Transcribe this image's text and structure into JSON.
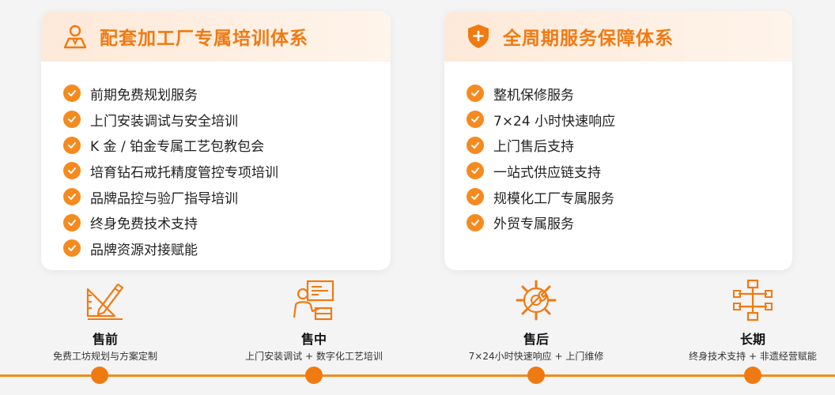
{
  "left_card": {
    "title": "配套加工厂专属培训体系",
    "icon": "person-icon",
    "items": [
      "前期免费规划服务",
      "上门安装调试与安全培训",
      "K 金 / 铂金专属工艺包教包会",
      "培育钻石戒托精度管控专项培训",
      "品牌品控与验厂指导培训",
      "终身免费技术支持",
      "品牌资源对接赋能"
    ]
  },
  "right_card": {
    "title": "全周期服务保障体系",
    "icon": "shield-plus-icon",
    "items": [
      "整机保修服务",
      "7×24 小时快速响应",
      "上门售后支持",
      "一站式供应链支持",
      "规模化工厂专属服务",
      "外贸专属服务"
    ]
  },
  "stages": [
    {
      "title": "售前",
      "desc": "免费工坊规划与方案定制",
      "icon": "ruler-pencil-icon"
    },
    {
      "title": "售中",
      "desc": "上门安装调试 + 数字化工艺培训",
      "icon": "trainer-board-icon"
    },
    {
      "title": "售后",
      "desc": "7×24小时快速响应 + 上门维修",
      "icon": "gear-wrench-icon"
    },
    {
      "title": "长期",
      "desc": "终身技术支持 + 非遗经营赋能",
      "icon": "flow-chart-icon"
    }
  ],
  "colors": {
    "accent": "#f07a12",
    "check": "#f58a1f",
    "header_bg": "#fde9d9"
  }
}
